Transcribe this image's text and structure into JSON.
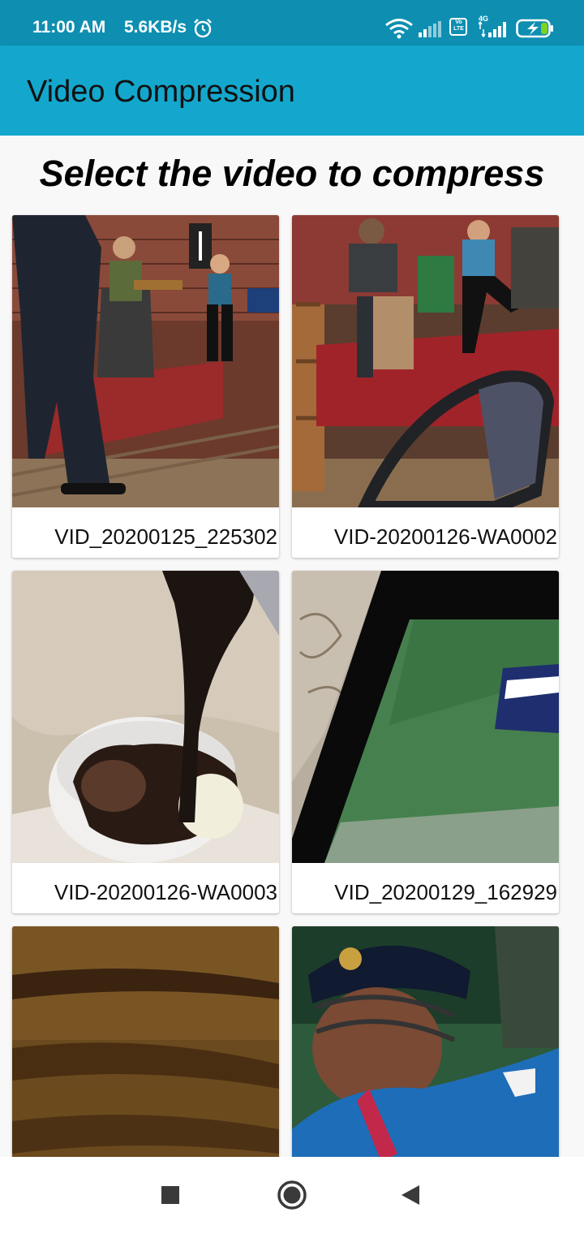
{
  "status_bar": {
    "time": "11:00 AM",
    "speed": "5.6KB/s",
    "icons": [
      "alarm-icon",
      "wifi-icon",
      "signal-icon",
      "volte-icon",
      "4g-signal-icon",
      "battery-charging-icon"
    ],
    "volte_text": "Vo LTE",
    "network_text": "4G"
  },
  "app_bar": {
    "title": "Video Compression"
  },
  "main": {
    "heading": "Select the video to compress",
    "videos": [
      {
        "name": "VID_20200125_225302"
      },
      {
        "name": "VID-20200126-WA0002"
      },
      {
        "name": "VID-20200126-WA0003"
      },
      {
        "name": "VID_20200129_162929"
      },
      {
        "name": ""
      },
      {
        "name": ""
      }
    ]
  },
  "nav_bar": {
    "icons": [
      "recents-square-icon",
      "home-circle-icon",
      "back-triangle-icon"
    ]
  },
  "colors": {
    "status_bar": "#0e8fb1",
    "app_bar": "#13a7cd",
    "background": "#f8f8f8"
  }
}
